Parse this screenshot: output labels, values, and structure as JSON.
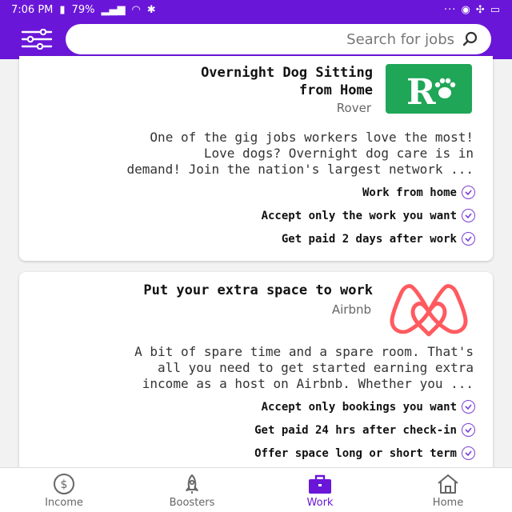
{
  "status_bar": {
    "time": "7:06 PM",
    "battery": "79%",
    "more": "···"
  },
  "search": {
    "placeholder": "Search for jobs"
  },
  "jobs": [
    {
      "title_line1": "Overnight Dog Sitting",
      "title_line2": "from Home",
      "company": "Rover",
      "desc_line1": "One of the gig jobs workers love the most!",
      "desc_line2": "Love dogs? Overnight dog care is in",
      "desc_line3": "demand! Join the nation's largest network ...",
      "bullets": [
        "Work from home",
        "Accept only the work you want",
        "Get paid 2 days after work"
      ]
    },
    {
      "title_line1": "Put your extra space to work",
      "company": "Airbnb",
      "desc_line1": "A bit of spare time and a spare room. That's",
      "desc_line2": "all you need to get started earning extra",
      "desc_line3": "income as a host on Airbnb. Whether you ...",
      "bullets": [
        "Accept only bookings you want",
        "Get paid 24 hrs after check-in",
        "Offer space long or short term"
      ]
    }
  ],
  "nav": {
    "home": "Home",
    "work": "Work",
    "boosters": "Boosters",
    "income": "Income"
  },
  "colors": {
    "brand": "#6a16d8",
    "rover_green": "#1fa657",
    "airbnb_red": "#ff5a5f"
  }
}
